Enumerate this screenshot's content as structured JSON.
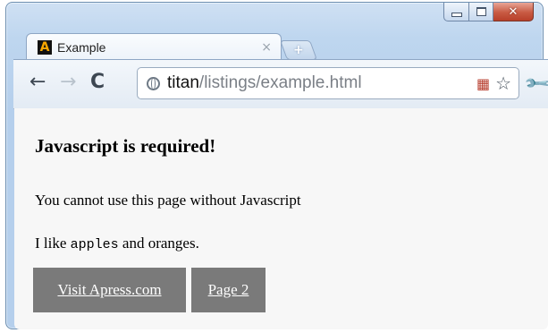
{
  "tab": {
    "title": "Example",
    "favicon_letter": "A",
    "close_glyph": "×",
    "newtab_glyph": "+"
  },
  "window_controls": {
    "close_glyph": "✕"
  },
  "toolbar": {
    "back_glyph": "←",
    "forward_glyph": "→",
    "reload_glyph": "C",
    "star_glyph": "☆",
    "wrench_glyph": "🔧",
    "page_icon_glyph": "▦"
  },
  "address": {
    "host": "titan",
    "path": "/listings/example.html"
  },
  "page": {
    "heading": "Javascript is required!",
    "paragraph1": "You cannot use this page without Javascript",
    "p2_before": "I like ",
    "p2_code": "apples",
    "p2_after": " and oranges.",
    "link1": "Visit Apress.com",
    "link2": "Page 2"
  },
  "colors": {
    "link_button_bg": "#7a7a7a",
    "link_text": "#ffffff",
    "frame": "#b5cfec",
    "close_button": "#c85a43"
  }
}
